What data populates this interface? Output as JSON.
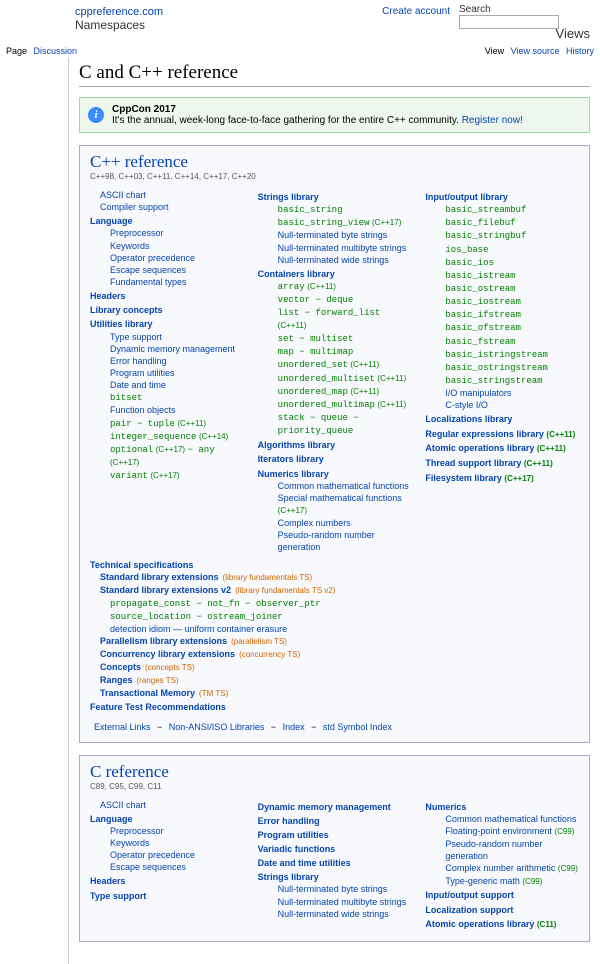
{
  "header": {
    "sitename": "cppreference.com",
    "create_account": "Create account",
    "search_label": "Search",
    "search_value": "",
    "namespaces_label": "Namespaces",
    "views_label": "Views",
    "left_tabs": [
      "Page",
      "Discussion"
    ],
    "right_tabs": [
      "View",
      "View source",
      "History"
    ]
  },
  "page_title": "C and C++ reference",
  "announce": {
    "title": "CppCon 2017",
    "text": "It's the annual, week-long face-to-face gathering for the entire C++ community.",
    "register": "Register now!"
  },
  "cpp": {
    "title": "C++ reference",
    "standards": "C++98, C++03, C++11, C++14, C++17, C++20",
    "col1": {
      "ascii": "ASCII chart",
      "compiler": "Compiler support",
      "lang": "Language",
      "preproc": "Preprocessor",
      "kw": "Keywords",
      "opprec": "Operator precedence",
      "esc": "Escape sequences",
      "fund": "Fundamental types",
      "headers": "Headers",
      "concepts": "Library concepts",
      "util": "Utilities library",
      "ts": "Type support",
      "dm": "Dynamic memory management",
      "eh": "Error handling",
      "pu": "Program utilities",
      "dt": "Date and time",
      "bs": "bitset",
      "fo": "Function objects",
      "pair": "pair − tuple",
      "pair_tag": "(C++11)",
      "is": "integer_sequence",
      "is_tag": "(C++14)",
      "opt": "optional",
      "opt_tag": "(C++17)",
      "any": "− any",
      "any_tag": "(C++17)",
      "var": "variant",
      "var_tag": "(C++17)"
    },
    "col2": {
      "strings": "Strings library",
      "bstr": "basic_string",
      "bsv": "basic_string_view",
      "bsv_tag": "(C++17)",
      "nbs": "Null-terminated byte strings",
      "nms": "Null-terminated multibyte strings",
      "nws": "Null-terminated wide strings",
      "cont": "Containers library",
      "arr": "array",
      "arr_tag": "(C++11)",
      "vec": "vector − deque",
      "list": "list − forward_list",
      "list_tag": "(C++11)",
      "set": "set − multiset",
      "map": "map − multimap",
      "us": "unordered_set",
      "us_tag": "(C++11)",
      "ums": "unordered_multiset",
      "ums_tag": "(C++11)",
      "um": "unordered_map",
      "um_tag": "(C++11)",
      "umm": "unordered_multimap",
      "umm_tag": "(C++11)",
      "stk": "stack − queue − priority_queue",
      "alg": "Algorithms library",
      "iter": "Iterators library",
      "num": "Numerics library",
      "cmf": "Common mathematical functions",
      "smf": "Special mathematical functions",
      "smf_tag": "(C++17)",
      "cn": "Complex numbers",
      "prng": "Pseudo-random number generation"
    },
    "col3": {
      "io": "Input/output library",
      "bsb": "basic_streambuf",
      "bfb": "basic_filebuf",
      "bsbf": "basic_stringbuf",
      "iob": "ios_base",
      "bi": "basic_ios",
      "bis": "basic_istream",
      "bos": "basic_ostream",
      "bios": "basic_iostream",
      "bif": "basic_ifstream",
      "bof": "basic_ofstream",
      "bfs": "basic_fstream",
      "biss": "basic_istringstream",
      "boss": "basic_ostringstream",
      "bss": "basic_stringstream",
      "iom": "I/O manipulators",
      "cio": "C-style I/O",
      "loc": "Localizations library",
      "re": "Regular expressions library",
      "re_tag": "(C++11)",
      "atom": "Atomic operations library",
      "atom_tag": "(C++11)",
      "thr": "Thread support library",
      "thr_tag": "(C++11)",
      "fs": "Filesystem library",
      "fs_tag": "(C++17)"
    },
    "tech": {
      "h0": "Technical specifications",
      "h1": "Standard library extensions",
      "h1n": "(library fundamentals TS)",
      "h2": "Standard library extensions v2",
      "h2n": "(library fundamentals TS v2)",
      "r1": "propagate_const − not_fn − observer_ptr",
      "r2": "source_location − ostream_joiner",
      "r3": "detection idiom — uniform container erasure",
      "h3": "Parallelism library extensions",
      "h3n": "(parallelism TS)",
      "h4": "Concurrency library extensions",
      "h4n": "(concurrency TS)",
      "h5": "Concepts",
      "h5n": "(concepts TS)",
      "h6": "Ranges",
      "h6n": "(ranges TS)",
      "h7": "Transactional Memory",
      "h7n": "(TM TS)",
      "h8": "Feature Test Recommendations"
    },
    "foot": {
      "el": "External Links",
      "na": "Non-ANSI/ISO Libraries",
      "idx": "Index",
      "si": "std Symbol Index"
    }
  },
  "c": {
    "title": "C reference",
    "standards": "C89, C95, C99, C11",
    "col1": {
      "ascii": "ASCII chart",
      "lang": "Language",
      "preproc": "Preprocessor",
      "kw": "Keywords",
      "opprec": "Operator precedence",
      "esc": "Escape sequences",
      "headers": "Headers",
      "ts": "Type support"
    },
    "col2": {
      "dm": "Dynamic memory management",
      "eh": "Error handling",
      "pu": "Program utilities",
      "vf": "Variadic functions",
      "dt": "Date and time utilities",
      "strings": "Strings library",
      "nbs": "Null-terminated byte strings",
      "nms": "Null-terminated multibyte strings",
      "nws": "Null-terminated wide strings"
    },
    "col3": {
      "num": "Numerics",
      "cmf": "Common mathematical functions",
      "fpe": "Floating-point environment",
      "fpe_tag": "(C99)",
      "prng": "Pseudo-random number generation",
      "cna": "Complex number arithmetic",
      "cna_tag": "(C99)",
      "tgm": "Type-generic math",
      "tgm_tag": "(C99)",
      "ios": "Input/output support",
      "loc": "Localization support",
      "atom": "Atomic operations library",
      "atom_tag": "(C11)"
    }
  }
}
